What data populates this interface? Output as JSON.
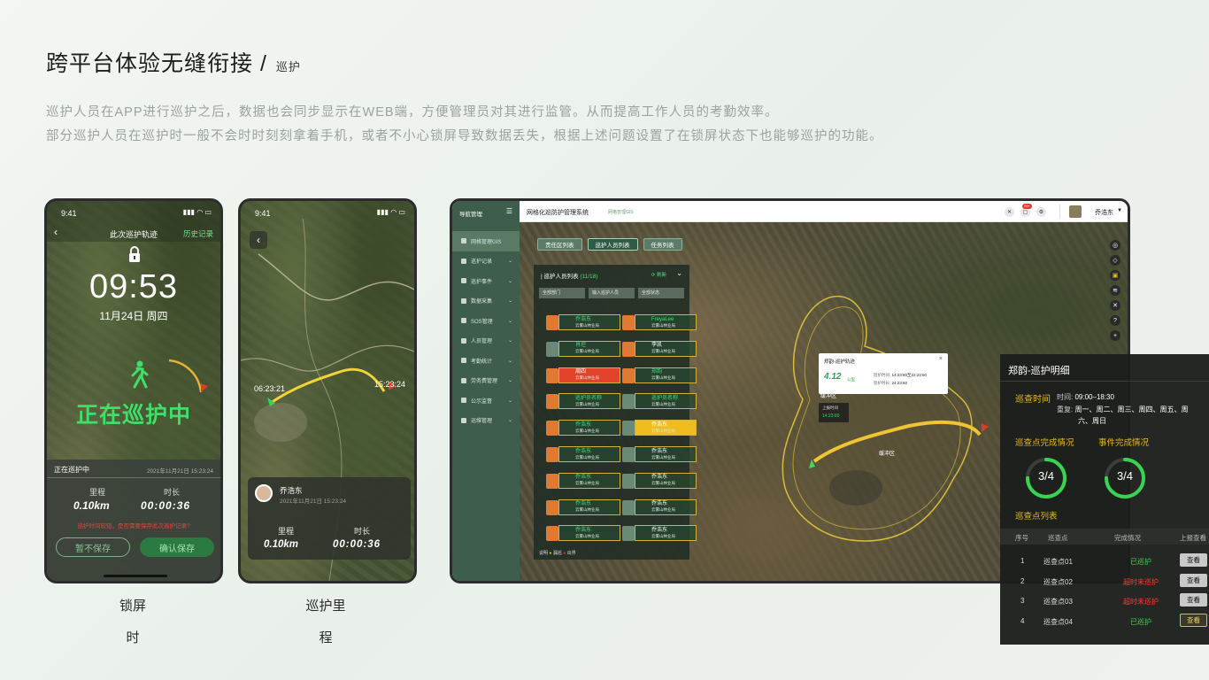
{
  "heading": {
    "title": "跨平台体验无缝衔接 /",
    "sub": "巡护"
  },
  "description": [
    "巡护人员在APP进行巡护之后，数据也会同步显示在WEB端，方便管理员对其进行监管。从而提高工作人员的考勤效率。",
    "部分巡护人员在巡护时一般不会时时刻刻拿着手机，或者不小心锁屏导致数据丢失，根据上述问题设置了在锁屏状态下也能够巡护的功能。"
  ],
  "phone1": {
    "time": "9:41",
    "nav_title": "此次巡护轨迹",
    "nav_right": "历史记录",
    "clock": "09:53",
    "date": "11月24日 周四",
    "status_big": "正在巡护中",
    "panel_title": "正在巡护中",
    "panel_date": "2021年11月21日 15:23:24",
    "dist_label": "里程",
    "dur_label": "时长",
    "dist_val": "0.10km",
    "dur_val": "00:00:36",
    "warning": "巡护时间较短，是否需要保存此次巡护记录?",
    "btn_nosave": "暂不保存",
    "btn_save": "确认保存",
    "caption_line1": "锁屏",
    "caption_line2": "时"
  },
  "phone2": {
    "time": "9:41",
    "start_time": "06:23:21",
    "end_time": "15:23:24",
    "user_name": "乔浩东",
    "user_date": "2021年11月21日 15:23:24",
    "dist_label": "里程",
    "dur_label": "时长",
    "dist_val": "0.10km",
    "dur_val": "00:00:36",
    "caption_line1": "巡护里",
    "caption_line2": "程"
  },
  "web": {
    "sidebar_title": "导航管理",
    "system_title": "网格化巡防护管理系统",
    "breadcrumb": "网格管理GIS",
    "user": "乔浩东",
    "badge": "99+",
    "menu": [
      "网格管理GIS",
      "巡护记录",
      "巡护事件",
      "数据采集",
      "SOS管理",
      "人员管理",
      "考勤统计",
      "劳务费管理",
      "公示监督",
      "运维管理"
    ],
    "tabs": [
      "责任区列表",
      "巡护人员列表",
      "任务列表"
    ],
    "list_title": "巡护人员列表",
    "list_count": "(11/18)",
    "refresh": "刷新",
    "filters": [
      "全部部门",
      "输入巡护人员",
      "全部状态"
    ],
    "people_left": [
      {
        "name": "乔浩东",
        "org": "云雾山林业局"
      },
      {
        "name": "肖坦",
        "org": "云雾山林业局"
      },
      {
        "name": "周四",
        "org": "云雾山林业局"
      },
      {
        "name": "巡护员名称",
        "org": "云雾山林业局"
      },
      {
        "name": "乔浩东",
        "org": "云雾山林业局"
      },
      {
        "name": "乔浩东",
        "org": "云雾山林业局"
      },
      {
        "name": "乔浩东",
        "org": "云雾山林业局"
      },
      {
        "name": "乔浩东",
        "org": "云雾山林业局"
      },
      {
        "name": "乔浩东",
        "org": "云雾山林业局"
      }
    ],
    "people_right": [
      {
        "name": "FreyaLee",
        "org": "云雾山林业局"
      },
      {
        "name": "李凯",
        "org": "云雾山林业局"
      },
      {
        "name": "郑韵",
        "org": "云雾山林业局"
      },
      {
        "name": "巡护员名称",
        "org": "云雾山林业局"
      },
      {
        "name": "乔浩东",
        "org": "云雾山林业局"
      },
      {
        "name": "乔浩东",
        "org": "云雾山林业局"
      },
      {
        "name": "乔浩东",
        "org": "云雾山林业局"
      },
      {
        "name": "乔浩东",
        "org": "云雾山林业局"
      },
      {
        "name": "乔浩东",
        "org": "云雾山林业局"
      }
    ],
    "legend_label": "说明",
    "legend_items": [
      "漏巡",
      "出界"
    ],
    "track_popup": {
      "title": "郑韵-巡护轨迹",
      "dist": "4.12",
      "dist_unit": "公里",
      "start_label": "巡护时间:",
      "start_val": "14:23:60至22:23:60",
      "dur_label": "巡护时长:",
      "dur_val": "24:23:60"
    },
    "report_popup": {
      "label": "上报时间",
      "time": "14:23:60"
    },
    "map_label1": "缓冲区",
    "map_label2": "缓冲区"
  },
  "detail": {
    "title": "郑韵-巡护明细",
    "patrol_time_label": "巡查时间",
    "time_label": "时间:",
    "time_val": "09:00–18:30",
    "repeat_label": "重复:",
    "repeat_val1": "周一、周二、周三、周四、周五、周",
    "repeat_val2": "六、周日",
    "points_status_label": "巡查点完成情况",
    "events_status_label": "事件完成情况",
    "points_ratio": "3/4",
    "events_ratio": "3/4",
    "points_fraction": 0.75,
    "events_fraction": 0.75,
    "list_label": "巡查点列表",
    "headers": [
      "序号",
      "巡查点",
      "完成情况",
      "上报查看"
    ],
    "rows": [
      {
        "no": "1",
        "point": "巡查点01",
        "status": "已巡护",
        "action": "查看",
        "ok": true
      },
      {
        "no": "2",
        "point": "巡查点02",
        "status": "超时未巡护",
        "action": "查看",
        "ok": false
      },
      {
        "no": "3",
        "point": "巡查点03",
        "status": "超时未巡护",
        "action": "查看",
        "ok": false
      },
      {
        "no": "4",
        "point": "巡查点04",
        "status": "已巡护",
        "action": "查看",
        "ok": true
      }
    ],
    "colors": {
      "green": "#39d353",
      "red": "#ff3b2f",
      "gold": "#e8b923"
    }
  }
}
